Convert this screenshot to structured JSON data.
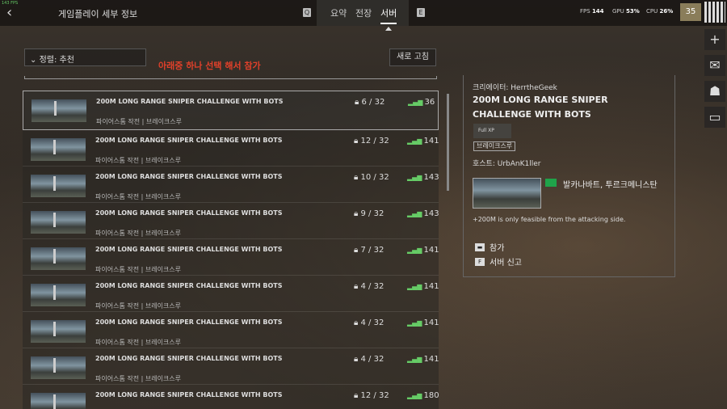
{
  "topbar": {
    "fps_small": "143 FPS",
    "title": "게임플레이 세부 정보",
    "key_left": "Q",
    "key_right": "E",
    "tabs": [
      {
        "label": "요약"
      },
      {
        "label": "전장"
      },
      {
        "label": "서버"
      }
    ],
    "fps_label": "FPS",
    "fps_value": "144",
    "gpu_label": "GPU",
    "gpu_value": "53%",
    "cpu_label": "CPU",
    "cpu_value": "26%",
    "level": "35"
  },
  "toolbar": {
    "sort_label": "정렬: 추천",
    "hint": "아래중 하나 선택 해서 참가",
    "refresh_label": "새로 고침"
  },
  "servers": [
    {
      "name": "200M LONG RANGE SNIPER CHALLENGE WITH BOTS",
      "sub": "파이어스톰 작전 | 브레이크스루",
      "players": "6 / 32",
      "ping": "36",
      "selected": true
    },
    {
      "name": "200M LONG RANGE SNIPER CHALLENGE WITH BOTS",
      "sub": "파이어스톰 작전 | 브레이크스루",
      "players": "12 / 32",
      "ping": "141"
    },
    {
      "name": "200M LONG RANGE SNIPER CHALLENGE WITH BOTS",
      "sub": "파이어스톰 작전 | 브레이크스루",
      "players": "10 / 32",
      "ping": "143"
    },
    {
      "name": "200M LONG RANGE SNIPER CHALLENGE WITH BOTS",
      "sub": "파이어스톰 작전 | 브레이크스루",
      "players": "9 / 32",
      "ping": "143"
    },
    {
      "name": "200M LONG RANGE SNIPER CHALLENGE WITH BOTS",
      "sub": "파이어스톰 작전 | 브레이크스루",
      "players": "7 / 32",
      "ping": "141"
    },
    {
      "name": "200M LONG RANGE SNIPER CHALLENGE WITH BOTS",
      "sub": "파이어스톰 작전 | 브레이크스루",
      "players": "4 / 32",
      "ping": "141"
    },
    {
      "name": "200M LONG RANGE SNIPER CHALLENGE WITH BOTS",
      "sub": "파이어스톰 작전 | 브레이크스루",
      "players": "4 / 32",
      "ping": "141"
    },
    {
      "name": "200M LONG RANGE SNIPER CHALLENGE WITH BOTS",
      "sub": "파이어스톰 작전 | 브레이크스루",
      "players": "4 / 32",
      "ping": "141"
    },
    {
      "name": "200M LONG RANGE SNIPER CHALLENGE WITH BOTS",
      "sub": "파이어스톰 작전 | 브레이크스루",
      "players": "12 / 32",
      "ping": "180"
    }
  ],
  "detail": {
    "creator": "크리에이터: HerrtheGeek",
    "name": "200M LONG RANGE SNIPER CHALLENGE WITH BOTS",
    "xp_badge": "Full XP",
    "mode_tag": "브레이크스루",
    "host": "호스트: UrbAnK1ller",
    "map_name": "발카나바트, 투르크메니스탄",
    "description": "+200M is only feasible from the attacking side.",
    "join_label": "참가",
    "report_label": "서버 신고"
  },
  "colors": {
    "hint": "#e0402a",
    "ping_bars": "#66cc66",
    "flag": "#1fa34a"
  },
  "icons": [
    "back-arrow-icon",
    "plus-icon",
    "mail-icon",
    "squad-icon",
    "card-icon",
    "signal-icon",
    "lock-icon"
  ]
}
